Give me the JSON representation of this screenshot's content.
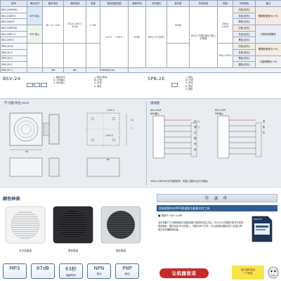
{
  "spec": {
    "headers": [
      "型号",
      "输出形式",
      "额定电压",
      "消耗电流",
      "音量",
      "使用温度范围",
      "播放时间",
      "文件格式",
      "音乐数",
      "外部控制",
      "质量",
      "外形颜色",
      "备注"
    ],
    "models": [
      "BSV-24NP(W)",
      "BSV-24NP-G",
      "BSV-24N-K",
      "BSV-24PP(W)",
      "BSV-24PP-G",
      "BSV-24P-K",
      "SPB-2E-W",
      "SPB-2E-G",
      "SPB-2E-K",
      "SPB-2E-S"
    ],
    "npn": "NPN\n输入",
    "pnp": "PNP\n输入",
    "voltage": "DC 12~24V",
    "current": "DC12,24V\n2\n3.0W",
    "power": "3.3W",
    "volume": "95dB",
    "temp": "-10°C\n~\n+50°C",
    "time": "63秒",
    "format": "MP3\n(2个文件)",
    "external": "BSV4\n只限正面分\n插入式电源",
    "weight": "180g\n±10%",
    "colors": [
      "白色(亚光)",
      "灰色(亚光)",
      "黑色(亚光)",
      "银色(亚光)"
    ],
    "notes": [
      "需搭配语音卡(→P.)",
      "内附/另附警铃",
      "需搭配语音卡(→P.)",
      "可选购警铃(→P.)"
    ],
    "bottom_left": "SPB-2E-□",
    "bottom_values": [
      "2W",
      "8Ω",
      "87dB(W/1m)"
    ],
    "bottom_weight": "85g\n±10%"
  },
  "codes": {
    "bsv_title": "BSV-24",
    "bsv_notes": [
      "□ 输出形式",
      "N: NPN输入",
      "P: PNP输入",
      "□ 颜色(选择)",
      "W: 白色",
      "G: 灰色",
      "K: 黑色"
    ],
    "spb_title": "SPB-2E",
    "spb_notes": [
      "□ 颜色",
      "W: 白色",
      "G: 灰色",
      "K: 黑色",
      "S: 银色"
    ]
  },
  "dimensions": {
    "title": "尺寸图(单位:mm)",
    "wiring_title": "接线图",
    "labels": [
      "4-Φ3.5",
      "90",
      "2-Φ3.5",
      "φ4",
      "14",
      "7"
    ],
    "wiring_models": [
      "BSV-24NP\nNPN输入",
      "BSV-24PP\nPNP输入"
    ],
    "wiring_labels": [
      "红(+)",
      "黑(−)",
      "白",
      "橙",
      "黄",
      "绿",
      "蓝",
      "紫",
      "灰"
    ],
    "footnote": "※BSV-24NP(W)为可选购型号，需插入语音卡后方可使用。"
  },
  "colors_section": {
    "title": "颜色种类",
    "speakers": [
      "本白色垂直",
      "黑色垂直",
      "银色垂直"
    ]
  },
  "features": [
    {
      "big": "MP3",
      "small": ""
    },
    {
      "big": "87dB",
      "small": ""
    },
    {
      "big": "63秒",
      "small": "播放时间"
    },
    {
      "big": "NPN",
      "small": "驱动"
    },
    {
      "big": "PNP",
      "small": "驱动"
    }
  ],
  "optional": {
    "title": "可 选 件",
    "subtitle": "用来更换内存MP3数据和功能模式的工具",
    "item": "■ 语音卡 SDV-128P",
    "para": "当中和客户工作基础操作并使用语音卡更改的发生方法。可以让卡片数据与制作分发的语音播放。通过对此SD卡的插入，切换为MP3文件，可以使用标准格式的工具进行声音文件的编辑和创建。",
    "card_label": "PATLITE"
  },
  "banner": {
    "pill": "让机器说话",
    "ad": "用大宝科技查\n一个网站"
  },
  "colors_hex": {
    "header_bg": "#dfe6ef",
    "band_bg": "#e9edf1",
    "accent_blue": "#2f5c93",
    "red": "#c62b2b",
    "yellow": "#f6e44a"
  }
}
